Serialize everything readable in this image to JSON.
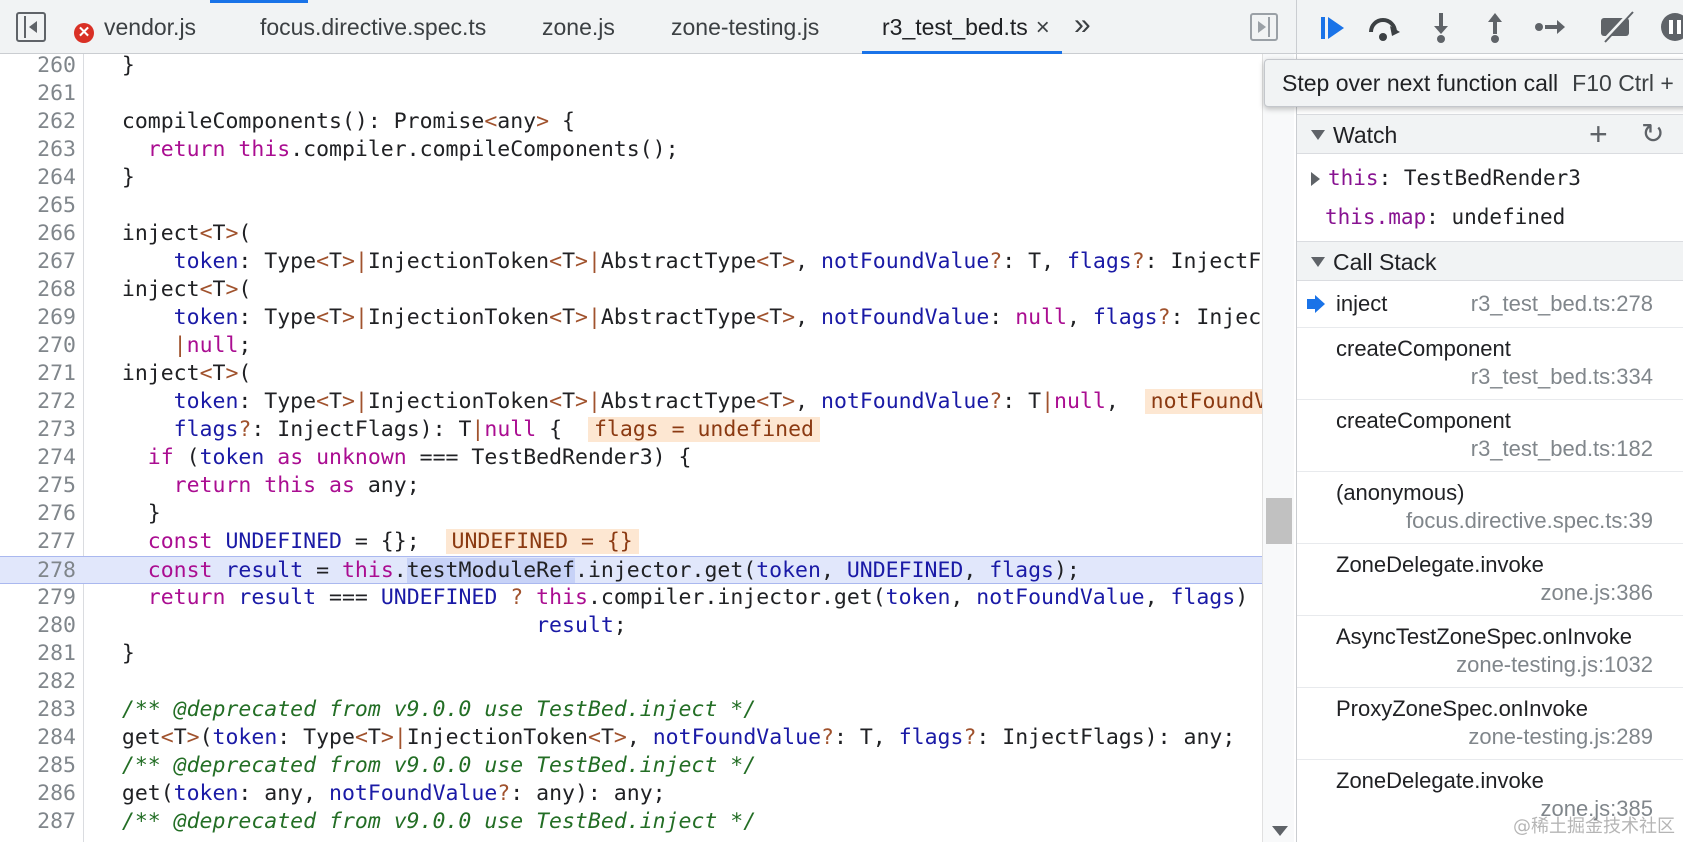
{
  "tabs": [
    {
      "label": "vendor.js",
      "has_error": true
    },
    {
      "label": "focus.directive.spec.ts"
    },
    {
      "label": "zone.js"
    },
    {
      "label": "zone-testing.js"
    },
    {
      "label": "r3_test_bed.ts",
      "active": true
    }
  ],
  "tab_more_glyph": "»",
  "close_glyph": "×",
  "error_glyph": "✕",
  "code_lines": [
    {
      "n": "260",
      "code": "  }"
    },
    {
      "n": "261",
      "code": ""
    },
    {
      "n": "262",
      "code": "  compileComponents(): Promise<any> {"
    },
    {
      "n": "263",
      "code": "    return this.compiler.compileComponents();"
    },
    {
      "n": "264",
      "code": "  }"
    },
    {
      "n": "265",
      "code": ""
    },
    {
      "n": "266",
      "code": "  inject<T>("
    },
    {
      "n": "267",
      "code": "      token: Type<T>|InjectionToken<T>|AbstractType<T>, notFoundValue?: T, flags?: InjectF"
    },
    {
      "n": "268",
      "code": "  inject<T>("
    },
    {
      "n": "269",
      "code": "      token: Type<T>|InjectionToken<T>|AbstractType<T>, notFoundValue: null, flags?: Injec"
    },
    {
      "n": "270",
      "code": "      |null;"
    },
    {
      "n": "271",
      "code": "  inject<T>("
    },
    {
      "n": "272",
      "code": "      token: Type<T>|InjectionToken<T>|AbstractType<T>, notFoundValue?: T|null,"
    },
    {
      "n": "273",
      "code": "      flags?: InjectFlags): T|null {"
    },
    {
      "n": "274",
      "code": "    if (token as unknown === TestBedRender3) {"
    },
    {
      "n": "275",
      "code": "      return this as any;"
    },
    {
      "n": "276",
      "code": "    }"
    },
    {
      "n": "277",
      "code": "    const UNDEFINED = {};"
    },
    {
      "n": "278",
      "code": "    const result = this.testModuleRef.injector.get(token, UNDEFINED, flags);"
    },
    {
      "n": "279",
      "code": "    return result === UNDEFINED ? this.compiler.injector.get(token, notFoundValue, flags)"
    },
    {
      "n": "280",
      "code": "                                  result;"
    },
    {
      "n": "281",
      "code": "  }"
    },
    {
      "n": "282",
      "code": ""
    },
    {
      "n": "283",
      "code": "  /** @deprecated from v9.0.0 use TestBed.inject */"
    },
    {
      "n": "284",
      "code": "  get<T>(token: Type<T>|InjectionToken<T>, notFoundValue?: T, flags?: InjectFlags): any;"
    },
    {
      "n": "285",
      "code": "  /** @deprecated from v9.0.0 use TestBed.inject */"
    },
    {
      "n": "286",
      "code": "  get(token: any, notFoundValue?: any): any;"
    },
    {
      "n": "287",
      "code": "  /** @deprecated from v9.0.0 use TestBed.inject */"
    }
  ],
  "inline_values": {
    "line_272": "notFoundV",
    "line_273": "flags = undefined",
    "line_277": "UNDEFINED = {}"
  },
  "tooltip": {
    "text": "Step over next function call",
    "shortcut": "F10  Ctrl +"
  },
  "watch": {
    "title": "Watch",
    "add_glyph": "+",
    "refresh_glyph": "↻",
    "items": [
      {
        "expr": "this",
        "value": "TestBedRender3"
      },
      {
        "expr": "this.map",
        "value": "undefined"
      }
    ]
  },
  "call_stack": {
    "title": "Call Stack",
    "frames": [
      {
        "name": "inject",
        "location": "r3_test_bed.ts:278",
        "current": true
      },
      {
        "name": "createComponent",
        "location": "r3_test_bed.ts:334"
      },
      {
        "name": "createComponent",
        "location": "r3_test_bed.ts:182"
      },
      {
        "name": "(anonymous)",
        "location": "focus.directive.spec.ts:39"
      },
      {
        "name": "ZoneDelegate.invoke",
        "location": "zone.js:386"
      },
      {
        "name": "AsyncTestZoneSpec.onInvoke",
        "location": "zone-testing.js:1032"
      },
      {
        "name": "ProxyZoneSpec.onInvoke",
        "location": "zone-testing.js:289"
      },
      {
        "name": "ZoneDelegate.invoke",
        "location": "zone.js:385"
      }
    ]
  },
  "watermark": "@稀土掘金技术社区"
}
